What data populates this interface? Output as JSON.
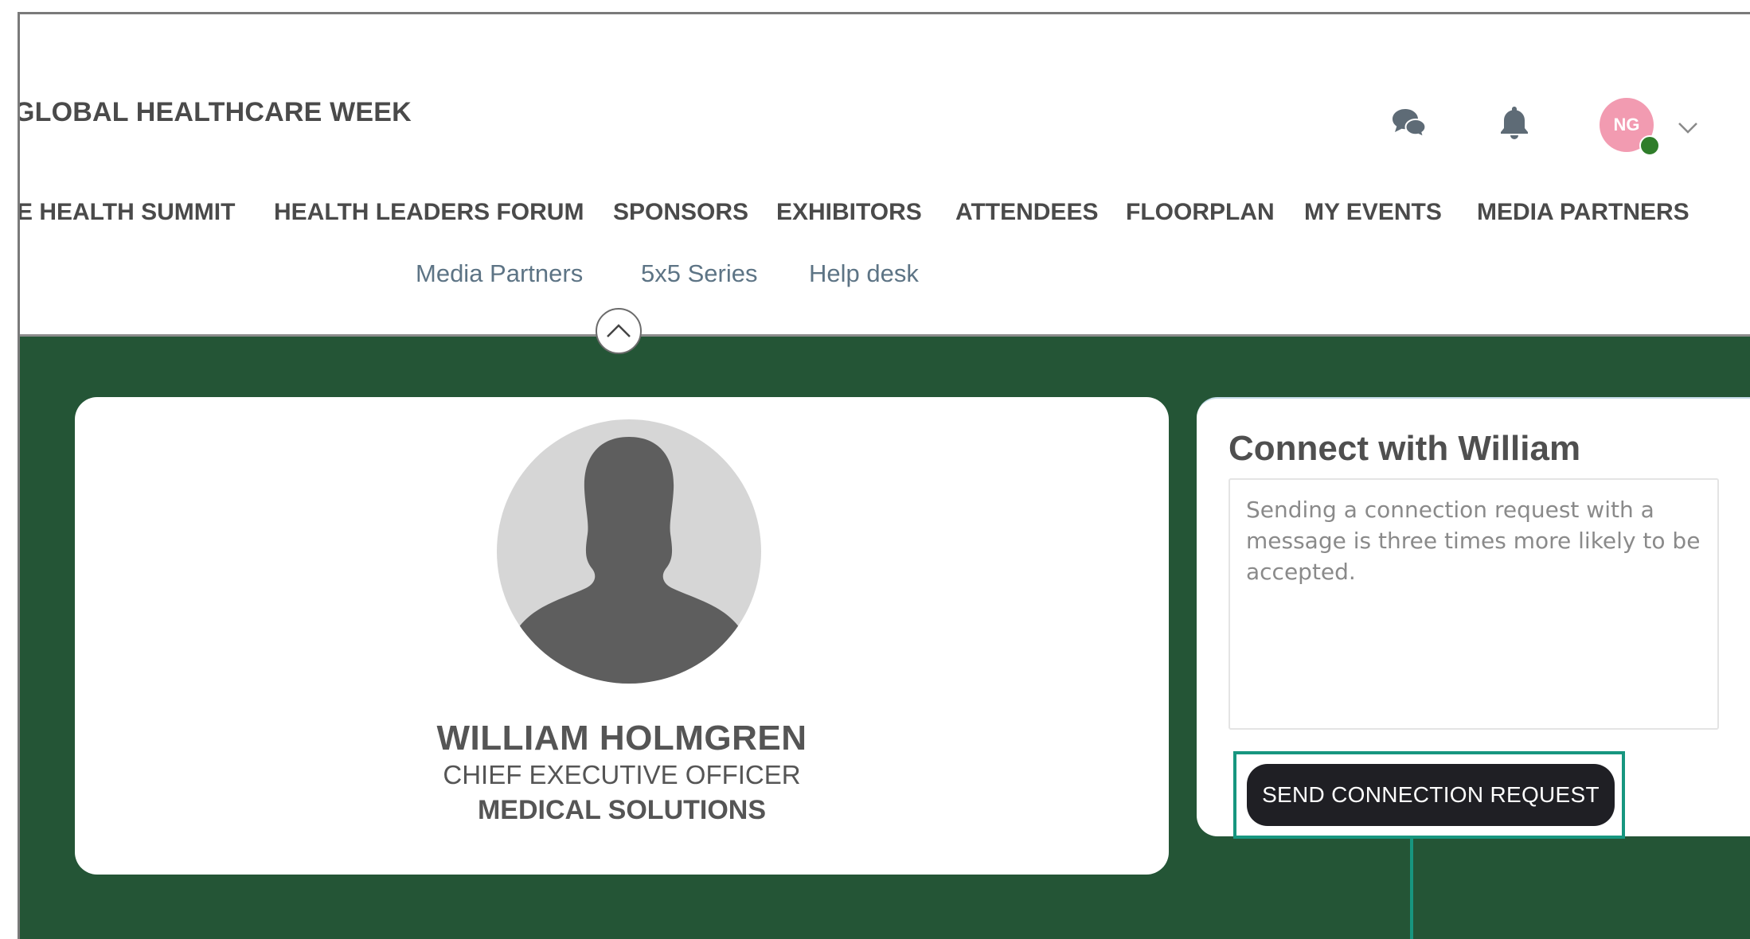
{
  "header": {
    "site_title": "GLOBAL HEALTHCARE WEEK",
    "user_initials": "NG",
    "nav_items": [
      "E HEALTH SUMMIT",
      "HEALTH LEADERS FORUM",
      "SPONSORS",
      "EXHIBITORS",
      "ATTENDEES",
      "FLOORPLAN",
      "MY EVENTS",
      "MEDIA PARTNERS"
    ],
    "subnav_items": [
      "Media Partners",
      "5x5 Series",
      "Help desk"
    ]
  },
  "icons": {
    "chat": "chat-bubbles-icon",
    "notifications": "bell-icon",
    "account_menu": "chevron-down-icon",
    "collapse": "chevron-up-icon",
    "avatar": "person-silhouette-icon"
  },
  "profile": {
    "name": "WILLIAM HOLMGREN",
    "job_title": "CHIEF EXECUTIVE OFFICER",
    "company": "MEDICAL SOLUTIONS"
  },
  "connect": {
    "heading": "Connect with William",
    "message_placeholder": "Sending a connection request with a message is three times more likely to be accepted.",
    "message_value": "",
    "send_button_label": "SEND CONNECTION REQUEST"
  },
  "colors": {
    "page_background": "#245536",
    "highlight": "#17967f",
    "avatar_badge": "#f29bb1",
    "online_status": "#2f7d2a",
    "subnav_text": "#5d7485",
    "button_background": "#1f1f24"
  }
}
